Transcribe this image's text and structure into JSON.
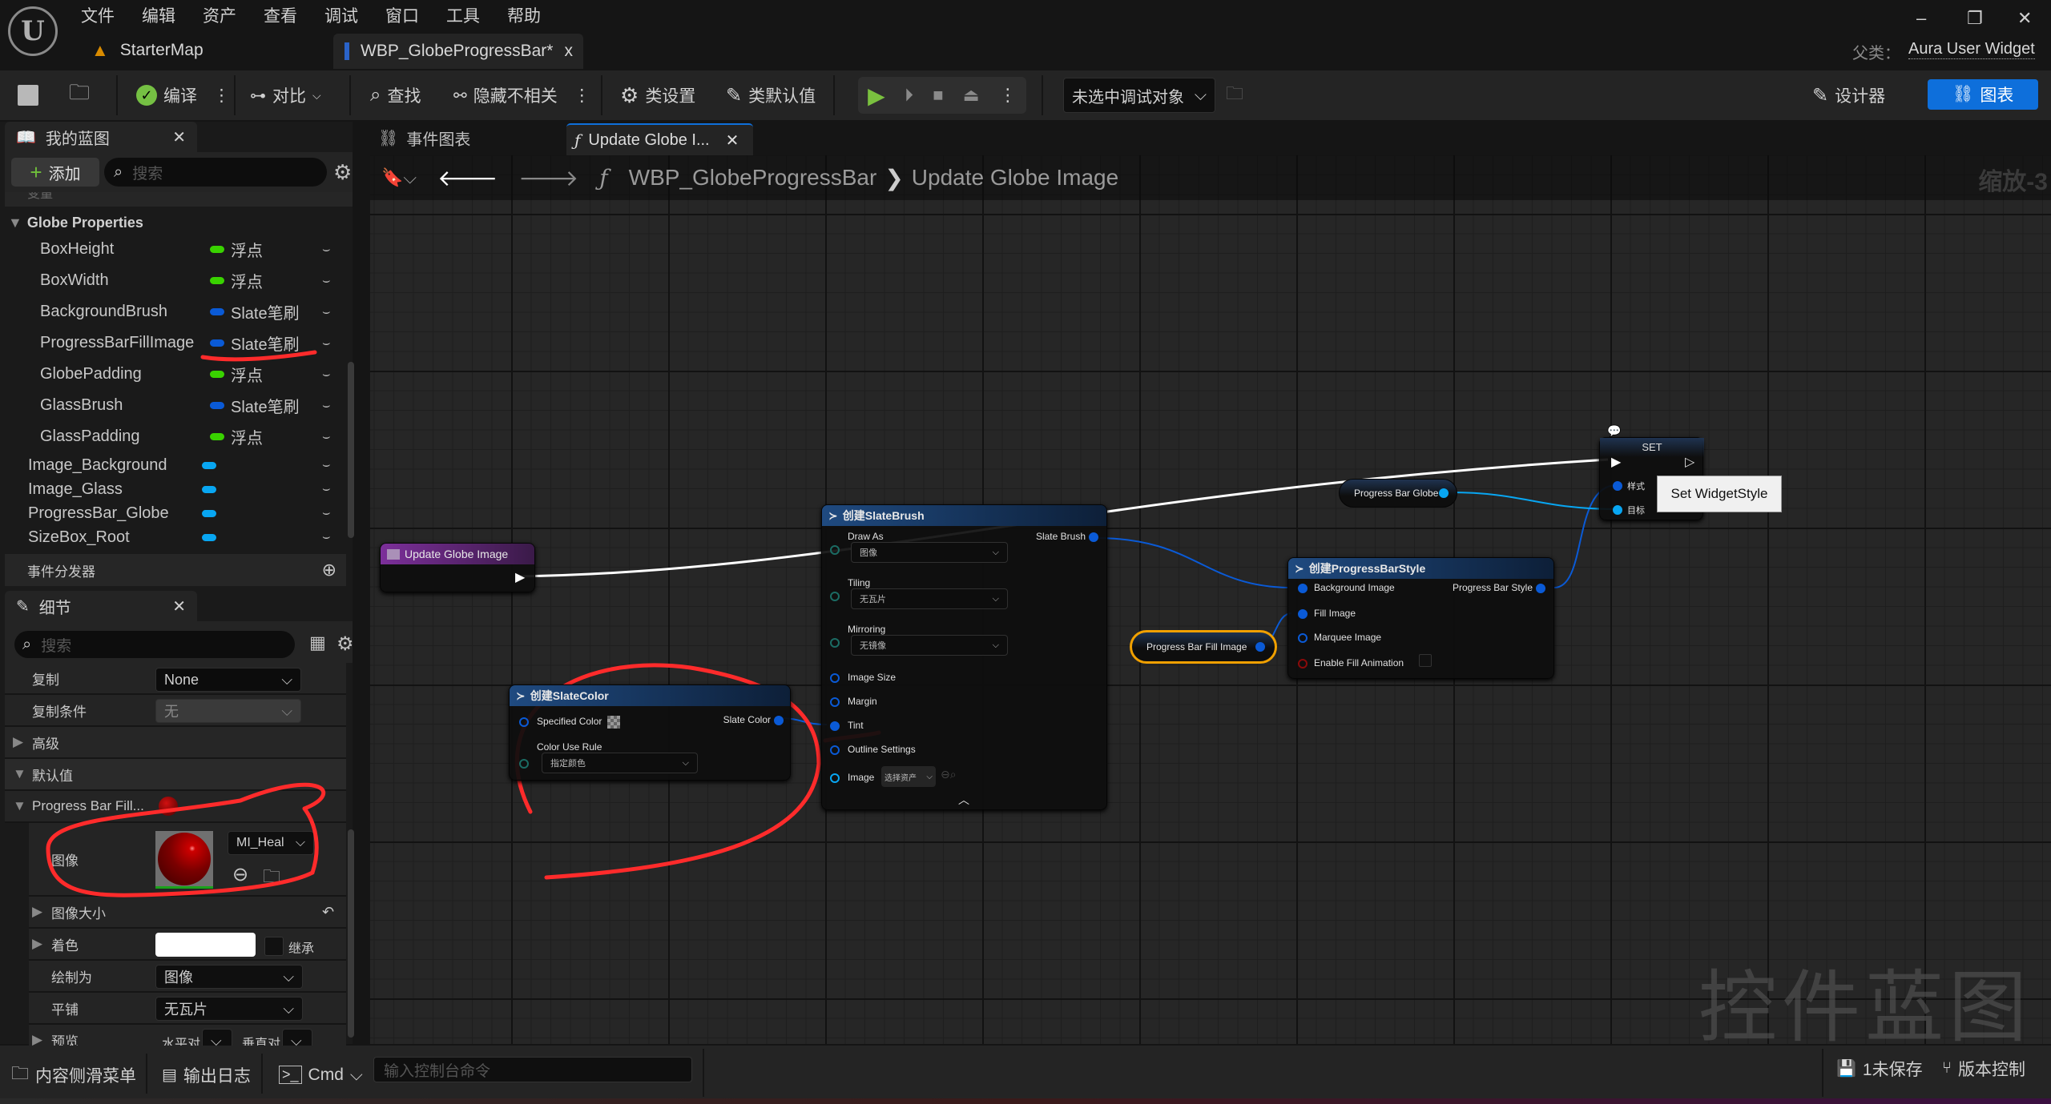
{
  "menu": [
    "文件",
    "编辑",
    "资产",
    "查看",
    "调试",
    "窗口",
    "工具",
    "帮助"
  ],
  "tabs": {
    "starter_map": "StarterMap",
    "active_doc": "WBP_GlobeProgressBar*",
    "close": "x"
  },
  "parent_class": {
    "label": "父类：",
    "value": "Aura User Widget"
  },
  "window": {
    "minimize": "–",
    "restore": "❐",
    "close": "✕"
  },
  "toolbar": {
    "compile": "编译",
    "diff": "对比",
    "find": "查找",
    "hide_unrelated": "隐藏不相关",
    "class_settings": "类设置",
    "class_defaults": "类默认值",
    "debug_target": "未选中调试对象",
    "designer": "设计器",
    "graph": "图表"
  },
  "my_blueprint": {
    "title": "我的蓝图",
    "add": "添加",
    "search_placeholder": "搜索",
    "section_cut": "变量",
    "category": "Globe Properties",
    "variables": [
      {
        "name": "BoxHeight",
        "type": "浮点",
        "color": "#39d200"
      },
      {
        "name": "BoxWidth",
        "type": "浮点",
        "color": "#39d200"
      },
      {
        "name": "BackgroundBrush",
        "type": "Slate笔刷",
        "color": "#0a5ad6"
      },
      {
        "name": "ProgressBarFillImage",
        "type": "Slate笔刷",
        "color": "#0a5ad6"
      },
      {
        "name": "GlobePadding",
        "type": "浮点",
        "color": "#39d200"
      },
      {
        "name": "GlassBrush",
        "type": "Slate笔刷",
        "color": "#0a5ad6"
      },
      {
        "name": "GlassPadding",
        "type": "浮点",
        "color": "#39d200"
      }
    ],
    "widgets": [
      {
        "name": "Image_Background",
        "color": "#08a6f2"
      },
      {
        "name": "Image_Glass",
        "color": "#08a6f2"
      },
      {
        "name": "ProgressBar_Globe",
        "color": "#08a6f2"
      },
      {
        "name": "SizeBox_Root",
        "color": "#08a6f2"
      }
    ],
    "event_dispatchers": "事件分发器"
  },
  "details": {
    "title": "细节",
    "search_placeholder": "搜索",
    "replication": {
      "label": "复制",
      "value": "None"
    },
    "replication_condition": {
      "label": "复制条件",
      "value": "无"
    },
    "advanced": "高级",
    "defaults": "默认值",
    "progress_bar_fill": "Progress Bar Fill...",
    "image": {
      "label": "图像",
      "asset": "MI_Heal"
    },
    "image_size": "图像大小",
    "tint": {
      "label": "着色",
      "inherit": "继承"
    },
    "draw_as": {
      "label": "绘制为",
      "value": "图像"
    },
    "tiling": {
      "label": "平铺",
      "value": "无瓦片"
    },
    "preview": {
      "label": "预览",
      "h": "水平对",
      "v": "垂直对"
    }
  },
  "graph_tabs": {
    "event_graph": "事件图表",
    "function": "Update Globe I..."
  },
  "breadcrumb": {
    "root": "WBP_GlobeProgressBar",
    "sep": "❯",
    "current": "Update Globe Image"
  },
  "zoom_label": "缩放-3",
  "watermark": "控件蓝图",
  "nodes": {
    "entry": {
      "title": "Update Globe Image"
    },
    "make_slate_brush": {
      "title": "创建SlateBrush",
      "draw_as": "Draw As",
      "draw_as_val": "图像",
      "tiling": "Tiling",
      "tiling_val": "无瓦片",
      "mirroring": "Mirroring",
      "mirroring_val": "无镜像",
      "image_size": "Image Size",
      "margin": "Margin",
      "tint": "Tint",
      "outline": "Outline Settings",
      "image": "Image",
      "image_val": "选择资产",
      "out": "Slate Brush"
    },
    "make_slate_color": {
      "title": "创建SlateColor",
      "specified": "Specified Color",
      "rule": "Color Use Rule",
      "rule_val": "指定颜色",
      "out": "Slate Color"
    },
    "make_pb_style": {
      "title": "创建ProgressBarStyle",
      "bg": "Background Image",
      "fill": "Fill Image",
      "marquee": "Marquee Image",
      "anim": "Enable Fill Animation",
      "out": "Progress Bar Style"
    },
    "var_fill": {
      "title": "Progress Bar Fill Image"
    },
    "var_globe": {
      "title": "Progress Bar Globe"
    },
    "set": {
      "title": "SET",
      "style": "样式",
      "target": "目标",
      "tooltip": "Set WidgetStyle"
    }
  },
  "statusbar": {
    "content_drawer": "内容侧滑菜单",
    "output_log": "输出日志",
    "cmd": "Cmd",
    "console_placeholder": "输入控制台命令",
    "unsaved": "1未保存",
    "source_control": "版本控制"
  }
}
